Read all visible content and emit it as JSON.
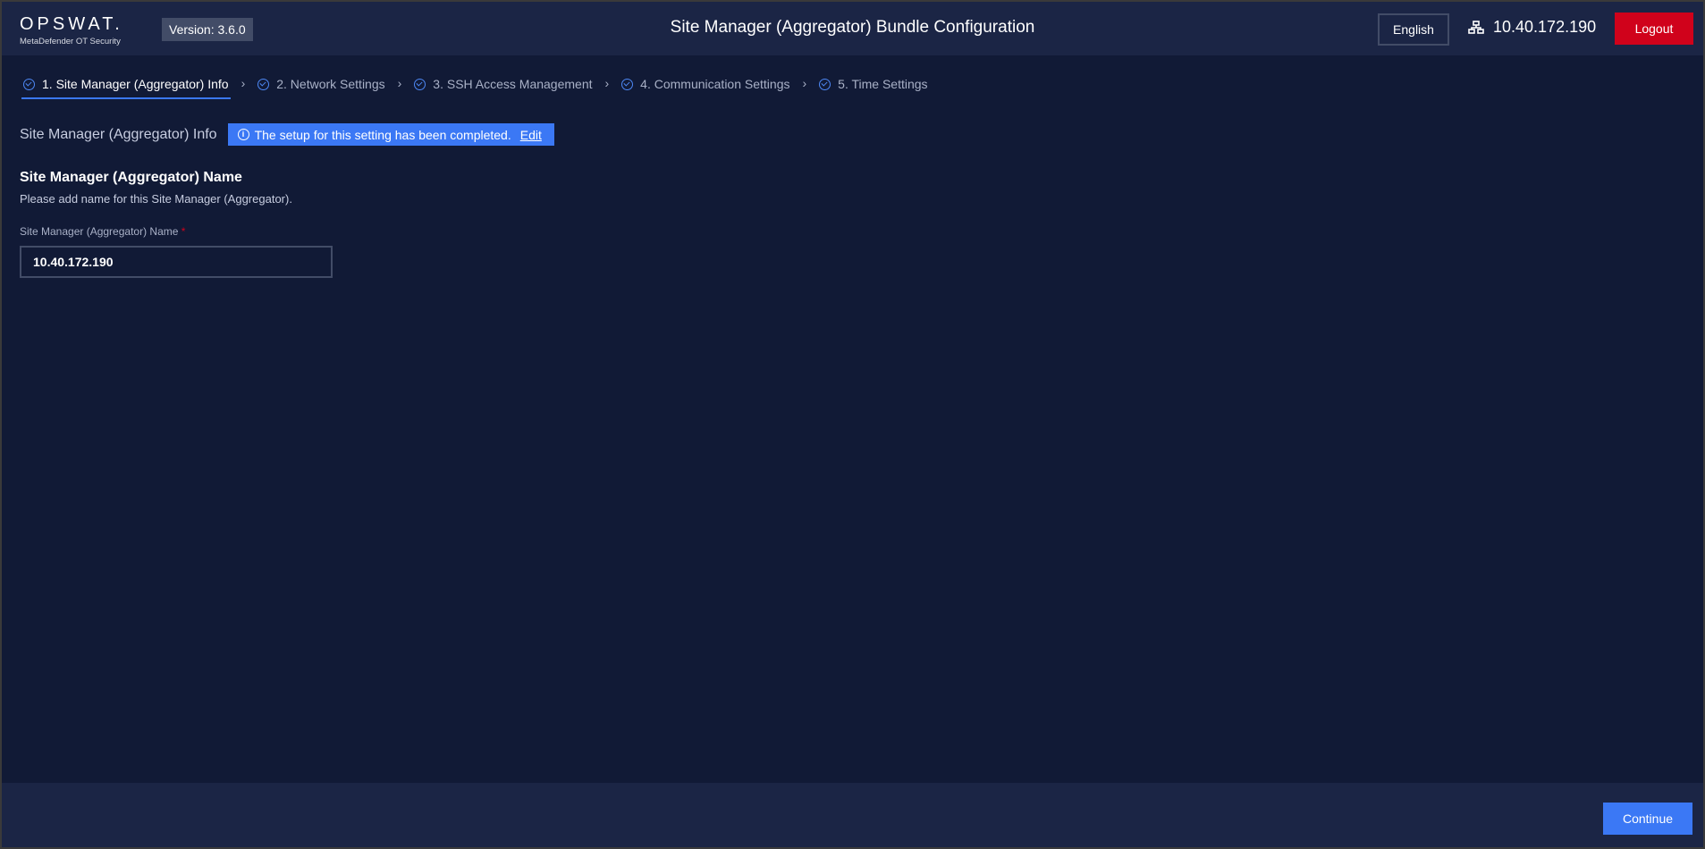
{
  "header": {
    "brand": "OPSWAT.",
    "product": "MetaDefender OT Security",
    "version": "Version: 3.6.0",
    "title": "Site Manager (Aggregator) Bundle Configuration",
    "language": "English",
    "ip": "10.40.172.190",
    "logout": "Logout"
  },
  "steps": [
    {
      "label": "1. Site Manager (Aggregator) Info",
      "active": true
    },
    {
      "label": "2. Network Settings"
    },
    {
      "label": "3. SSH Access Management"
    },
    {
      "label": "4. Communication Settings"
    },
    {
      "label": "5. Time Settings"
    }
  ],
  "info": {
    "title": "Site Manager (Aggregator) Info",
    "banner": "The setup for this setting has been completed.",
    "edit": "Edit"
  },
  "section": {
    "heading": "Site Manager (Aggregator) Name",
    "description": "Please add name for this Site Manager (Aggregator).",
    "field_label": "Site Manager (Aggregator) Name",
    "required": "*",
    "field_value": "10.40.172.190"
  },
  "footer": {
    "continue": "Continue"
  },
  "colors": {
    "accent": "#3b78f5",
    "danger": "#d0021b",
    "bg": "#111a36",
    "header": "#1b2545"
  }
}
